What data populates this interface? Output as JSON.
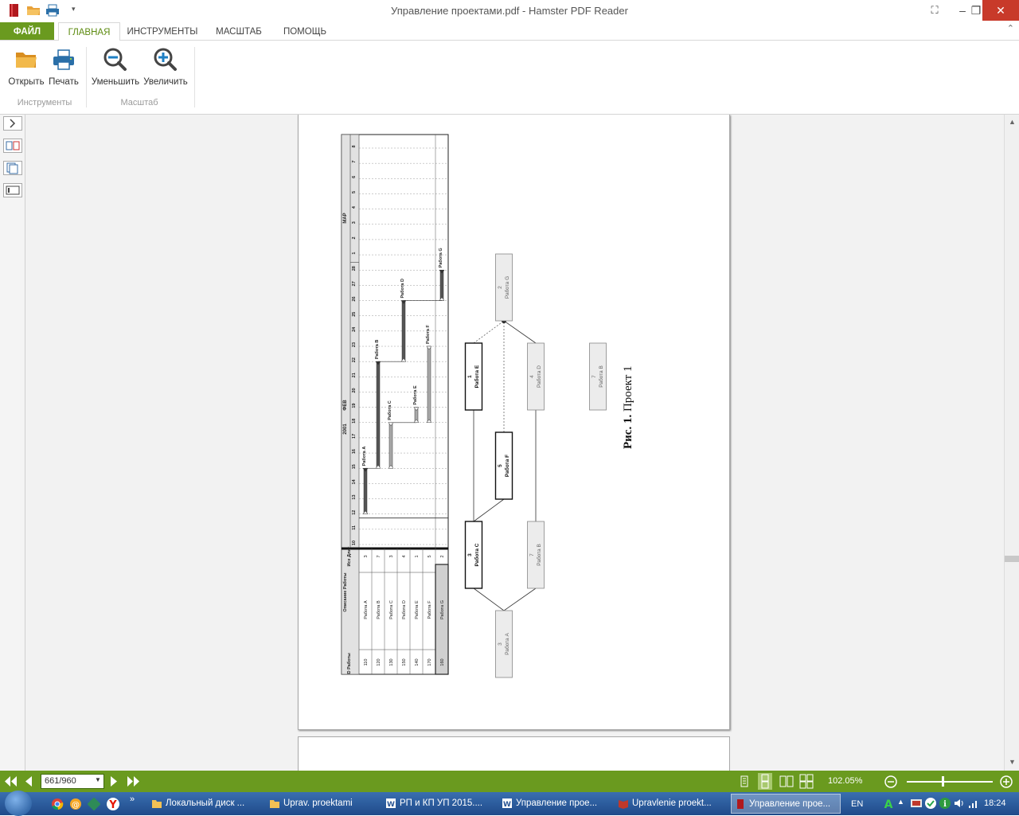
{
  "window": {
    "title": "Управление проектами.pdf - Hamster PDF Reader",
    "minimize": "–",
    "restore": "❐",
    "close": "✕"
  },
  "tabs": [
    "ФАЙЛ",
    "ГЛАВНАЯ",
    "ИНСТРУМЕНТЫ",
    "МАСШТАБ",
    "ПОМОЩЬ"
  ],
  "ribbon": {
    "open_label": "Открыть",
    "print_label": "Печать",
    "zoom_out_label": "Уменьшить",
    "zoom_in_label": "Увеличить",
    "group_tools": "Инструменты",
    "group_scale": "Масштаб"
  },
  "document": {
    "gantt": {
      "header_year": "2001",
      "month_feb": "ФЕВ",
      "month_mar": "МАР",
      "col_id": "ID Работы",
      "col_desc": "Описание Работы",
      "col_dur": "Исх Длит",
      "days": [
        "10",
        "11",
        "12",
        "13",
        "14",
        "15",
        "16",
        "17",
        "18",
        "19",
        "20",
        "21",
        "22",
        "23",
        "24",
        "25",
        "26",
        "27",
        "28",
        "1",
        "2",
        "3",
        "4",
        "5",
        "6",
        "7",
        "8"
      ],
      "rows": [
        {
          "id": "110",
          "name": "Работа A",
          "dur": "3"
        },
        {
          "id": "120",
          "name": "Работа B",
          "dur": "7"
        },
        {
          "id": "130",
          "name": "Работа C",
          "dur": "3"
        },
        {
          "id": "150",
          "name": "Работа D",
          "dur": "4"
        },
        {
          "id": "140",
          "name": "Работа E",
          "dur": "1"
        },
        {
          "id": "170",
          "name": "Работа F",
          "dur": "5"
        },
        {
          "id": "160",
          "name": "Работа G",
          "dur": "2"
        }
      ],
      "bar_labels": [
        "Работа A",
        "Работа B",
        "Работа C",
        "Работа D",
        "Работа E",
        "Работа F",
        "Работа G"
      ]
    },
    "network": {
      "nodes": [
        {
          "num": "3",
          "name": "Работа A"
        },
        {
          "num": "7",
          "name": "Работа B"
        },
        {
          "num": "3",
          "name": "Работа C"
        },
        {
          "num": "5",
          "name": "Работа F"
        },
        {
          "num": "1",
          "name": "Работа E"
        },
        {
          "num": "4",
          "name": "Работа D"
        },
        {
          "num": "2",
          "name": "Работа G"
        },
        {
          "num": "7",
          "name": "Работа B"
        }
      ]
    },
    "caption_bold": "Рис. 1.",
    "caption_text": "Проект 1"
  },
  "statusbar": {
    "page_value": "661/960",
    "zoom": "102.05%"
  },
  "taskbar": {
    "items": [
      "Локальный диск ...",
      "Uprav. proektami",
      "РП и КП  УП 2015....",
      "Управление прое...",
      "Upravlenie proekt...",
      "Управление прое..."
    ],
    "lang": "EN",
    "time": "18:24"
  },
  "colors": {
    "accent_green": "#6a9a1f",
    "close_red": "#c83a2a",
    "taskbar_blue": "#2a5b9c"
  }
}
